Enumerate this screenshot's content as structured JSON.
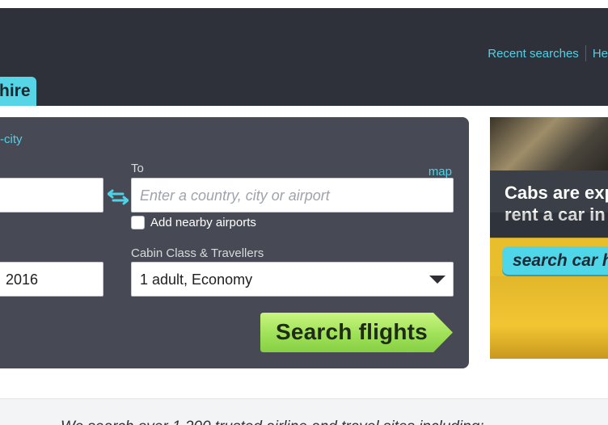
{
  "header": {
    "links": [
      "Recent searches",
      "He"
    ]
  },
  "tab": {
    "label": "hire"
  },
  "search_panel": {
    "multi_city_link": "-city",
    "to_label": "To",
    "map_link": "map",
    "to_placeholder": "Enter a country, city or airport",
    "nearby_label": "Add nearby airports",
    "date_value": "2016",
    "cabin_label": "Cabin Class & Travellers",
    "cabin_value": "1 adult, Economy",
    "search_button": "Search flights"
  },
  "ad": {
    "line1": "Cabs are exp",
    "line2": "rent a car in",
    "cta": "search car hi"
  },
  "footer": {
    "text": "We search over 1,200 trusted airline and travel sites including:"
  },
  "colors": {
    "accent": "#4fd2e6",
    "header_bg": "#2f313a",
    "panel_bg": "#474a54",
    "button_green": "#a3e35c"
  },
  "icons": {
    "swap": "swap-arrows-icon",
    "dropdown": "dropdown-arrow-icon",
    "checkbox": "checkbox-icon"
  }
}
